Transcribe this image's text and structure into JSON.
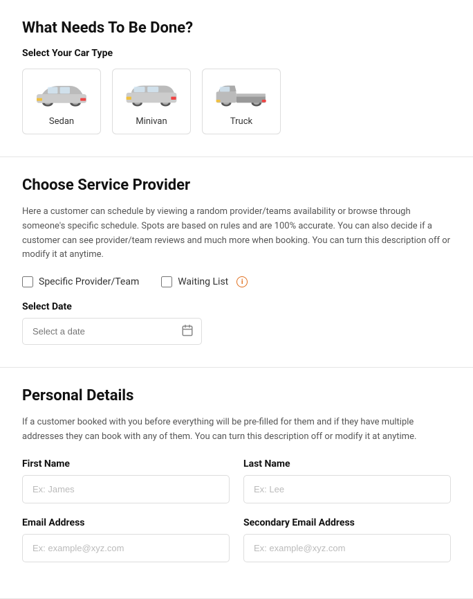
{
  "page": {
    "section1": {
      "title": "What Needs To Be Done?",
      "car_type_label": "Select Your Car Type",
      "cars": [
        {
          "id": "sedan",
          "label": "Sedan"
        },
        {
          "id": "minivan",
          "label": "Minivan"
        },
        {
          "id": "truck",
          "label": "Truck"
        }
      ]
    },
    "section2": {
      "title": "Choose Service Provider",
      "description": "Here a customer can schedule by viewing a random provider/teams availability or browse through someone's specific schedule. Spots are based on rules and are 100% accurate. You can also decide if a customer can see provider/team reviews and much more when booking. You can turn this description off or modify it at anytime.",
      "specific_provider_label": "Specific Provider/Team",
      "waiting_list_label": "Waiting List",
      "date_label": "Select Date",
      "date_placeholder": "Select a date"
    },
    "section3": {
      "title": "Personal Details",
      "description": "If a customer booked with you before everything will be pre-filled for them and if they have multiple addresses they can book with any of them. You can turn this description off or modify it at anytime.",
      "first_name_label": "First Name",
      "first_name_placeholder": "Ex: James",
      "last_name_label": "Last Name",
      "last_name_placeholder": "Ex: Lee",
      "email_label": "Email Address",
      "email_placeholder": "Ex: example@xyz.com",
      "secondary_email_label": "Secondary Email Address",
      "secondary_email_placeholder": "Ex: example@xyz.com"
    }
  }
}
